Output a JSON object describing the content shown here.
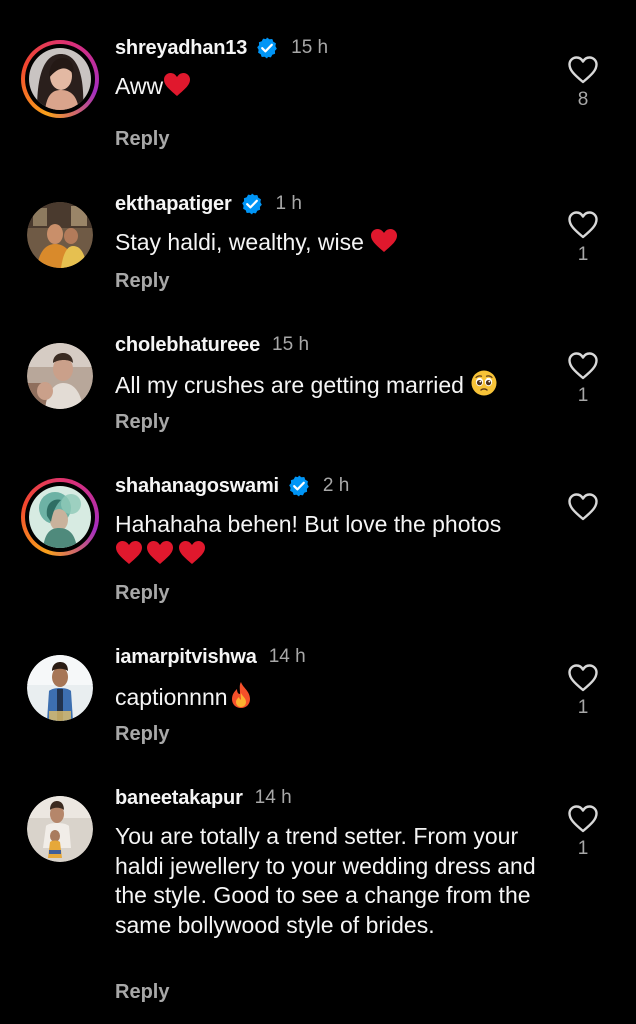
{
  "comments": [
    {
      "username": "shreyadhan13",
      "verified": true,
      "time": "15 h",
      "text": "Aww",
      "emojis": [
        "red-heart"
      ],
      "reply_label": "Reply",
      "likes": "8"
    },
    {
      "username": "ekthapatiger",
      "verified": true,
      "time": "1 h",
      "text": "Stay haldi, wealthy, wise ",
      "emojis": [
        "red-heart"
      ],
      "reply_label": "Reply",
      "likes": "1"
    },
    {
      "username": "cholebhatureee",
      "verified": false,
      "time": "15 h",
      "text": "All my crushes are getting married ",
      "emojis": [
        "pleading-face"
      ],
      "reply_label": "Reply",
      "likes": "1"
    },
    {
      "username": "shahanagoswami",
      "verified": true,
      "time": "2 h",
      "text": "Hahahaha behen! But love the photos",
      "emojis": [
        "red-heart",
        "red-heart",
        "red-heart"
      ],
      "reply_label": "Reply",
      "likes": ""
    },
    {
      "username": "iamarpitvishwa",
      "verified": false,
      "time": "14 h",
      "text": "captionnnn",
      "emojis": [
        "fire"
      ],
      "reply_label": "Reply",
      "likes": "1"
    },
    {
      "username": "baneetakapur",
      "verified": false,
      "time": "14 h",
      "text": "You are totally a trend setter. From your haldi jewellery to your wedding dress and the style. Good to see a change from the same bollywood style of brides.",
      "emojis": [],
      "reply_label": "Reply",
      "likes": "1"
    }
  ],
  "icons": {
    "verified": "verified-badge-icon",
    "like": "heart-outline-icon"
  },
  "colors": {
    "background": "#000000",
    "primary_text": "#f5f5f5",
    "secondary_text": "#a8a8a8",
    "verified_blue": "#0095f6",
    "emoji_red": "#e0182d"
  }
}
